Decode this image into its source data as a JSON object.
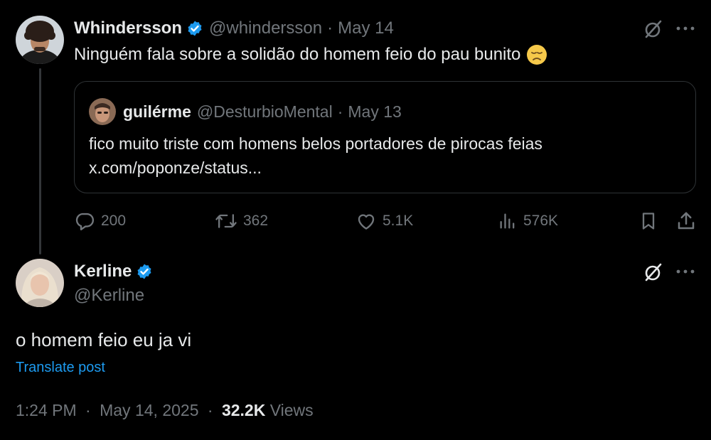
{
  "tweet": {
    "author_name": "Whindersson",
    "author_handle": "@whindersson",
    "date": "May 14",
    "text": "Ninguém fala sobre a solidão do homem feio do pau bunito",
    "emoji": "disappointed-face",
    "quote": {
      "author_name": "guilérme",
      "author_handle": "@DesturbioMental",
      "date": "May 13",
      "text": "fico muito triste com homens belos portadores de pirocas feias",
      "link": "x.com/poponze/status..."
    },
    "stats": {
      "replies": "200",
      "reposts": "362",
      "likes": "5.1K",
      "views": "576K"
    }
  },
  "reply": {
    "author_name": "Kerline",
    "author_handle": "@Kerline",
    "text": "o homem feio eu ja vi",
    "translate_label": "Translate post",
    "time": "1:24 PM",
    "date": "May 14, 2025",
    "views_count": "32.2K",
    "views_label": "Views"
  },
  "colors": {
    "background": "#000000",
    "text_primary": "#e7e9ea",
    "text_secondary": "#71767b",
    "accent": "#1d9bf0",
    "border": "#2f3336"
  },
  "separator": "·"
}
